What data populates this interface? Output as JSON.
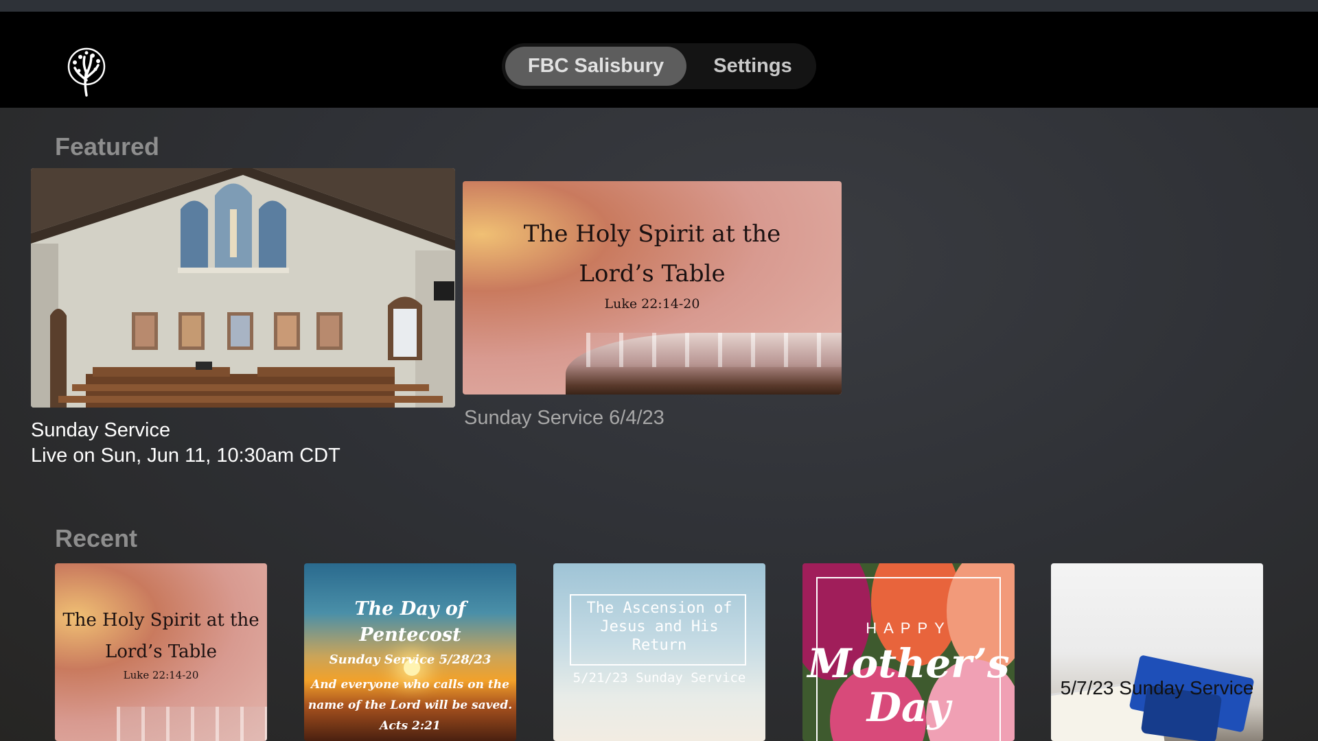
{
  "header": {
    "logo_icon": "tree-logo-icon",
    "tabs": [
      {
        "label": "FBC Salisbury",
        "selected": true
      },
      {
        "label": "Settings",
        "selected": false
      }
    ]
  },
  "featured": {
    "title": "Featured",
    "items": [
      {
        "title": "Sunday Service",
        "subtitle": "Live on Sun, Jun 11, 10:30am CDT",
        "image": "church-sanctuary-photo"
      },
      {
        "title": "Sunday Service 6/4/23",
        "image": "holy-spirit-thumbnail",
        "art": {
          "heading": "The Holy Spirit at the",
          "heading2": "Lord’s Table",
          "verse": "Luke 22:14-20"
        }
      }
    ]
  },
  "recent": {
    "title": "Recent",
    "items": [
      {
        "image": "holy-spirit-thumbnail",
        "art": {
          "heading": "The Holy Spirit at the",
          "heading2": "Lord’s Table",
          "verse": "Luke 22:14-20"
        }
      },
      {
        "image": "pentecost-sunrise-thumbnail",
        "art": {
          "heading": "The Day of Pentecost",
          "sub": "Sunday Service 5/28/23",
          "line1": "And everyone who calls on the",
          "line2": "name of the Lord will be saved.",
          "line3": "Acts 2:21"
        }
      },
      {
        "image": "sky-ascension-thumbnail",
        "art": {
          "l1": "The Ascension of",
          "l2": "Jesus and His",
          "l3": "Return",
          "sub": "5/21/23 Sunday Service"
        }
      },
      {
        "image": "tulips-thumbnail",
        "art": {
          "happy": "HAPPY",
          "big1": "Mother’s",
          "big2": "Day"
        }
      },
      {
        "image": "bible-graduation-cap-thumbnail",
        "art": {
          "label": "5/7/23 Sunday Service"
        }
      }
    ]
  },
  "colors": {
    "header_bg": "#000000",
    "tab_selected_bg": "#5d5d5d",
    "section_title": "#8e8e8e"
  }
}
